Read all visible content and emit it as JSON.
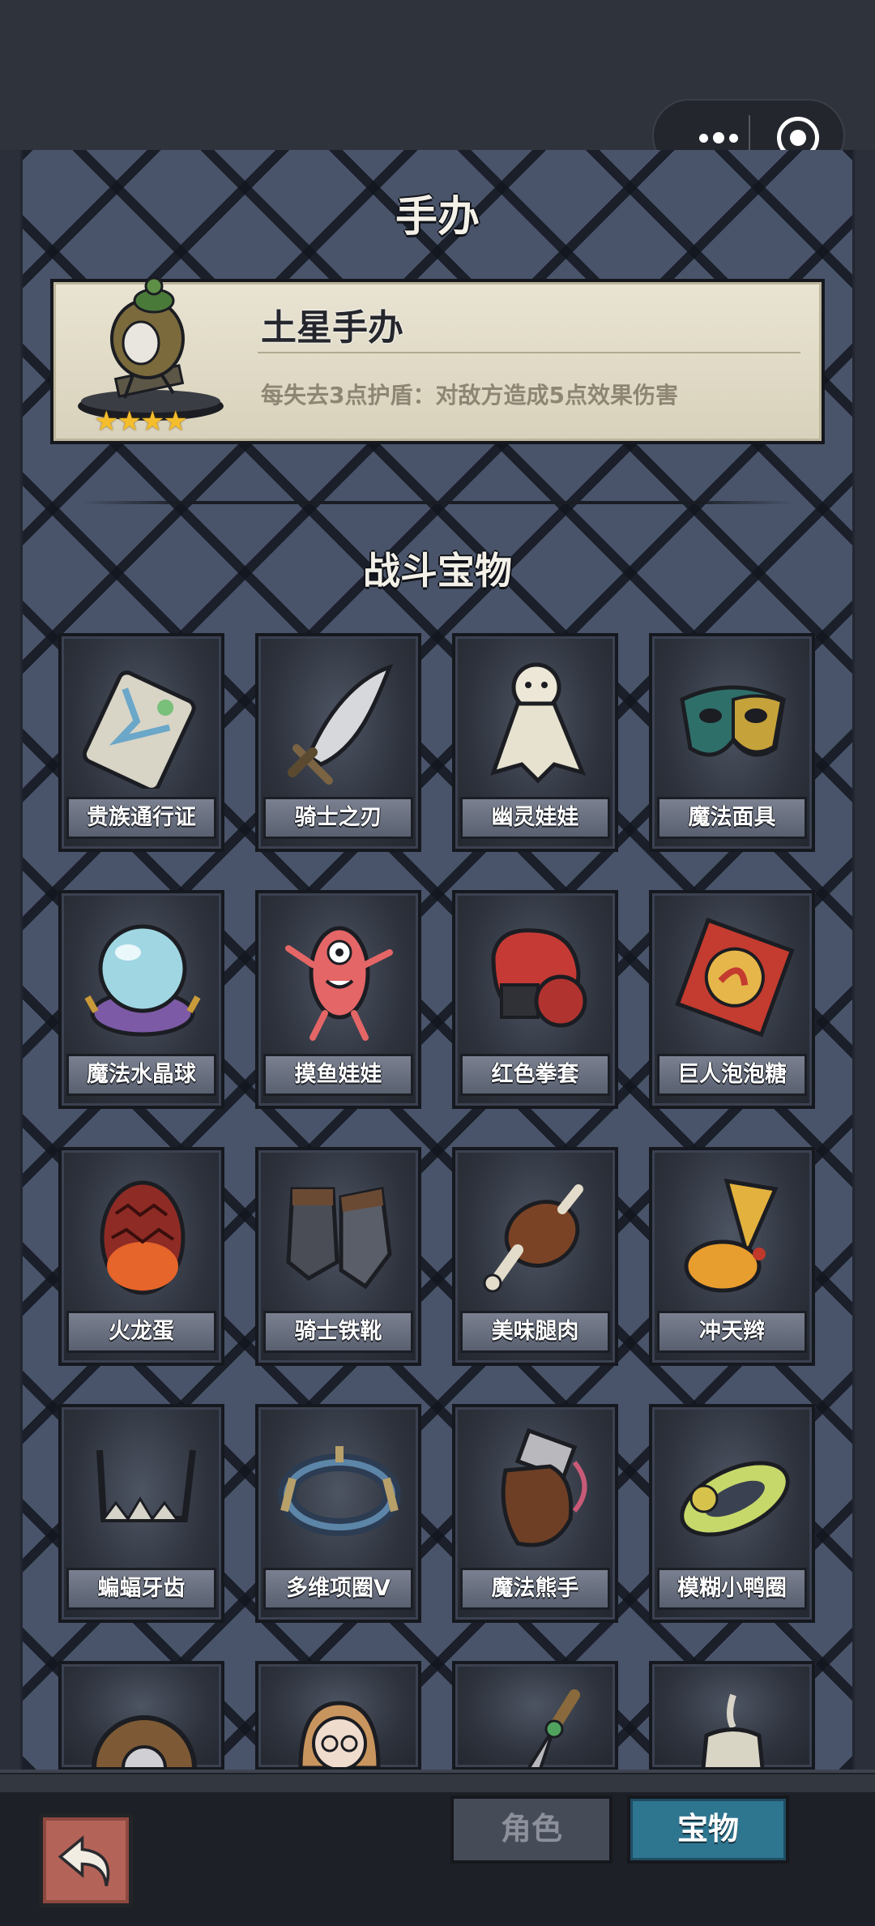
{
  "header": {
    "title": "手办",
    "more_icon": "more-dots-icon",
    "close_icon": "target-close-icon"
  },
  "figure": {
    "name": "土星手办",
    "description": "每失去3点护盾：对敌方造成5点效果伤害",
    "stars": 4
  },
  "section": {
    "title": "战斗宝物"
  },
  "items": [
    {
      "label": "贵族通行证",
      "icon": "noble-pass-card-icon"
    },
    {
      "label": "骑士之刃",
      "icon": "knight-blade-icon"
    },
    {
      "label": "幽灵娃娃",
      "icon": "ghost-doll-icon"
    },
    {
      "label": "魔法面具",
      "icon": "magic-mask-icon"
    },
    {
      "label": "魔法水晶球",
      "icon": "crystal-ball-icon"
    },
    {
      "label": "摸鱼娃娃",
      "icon": "slacker-doll-icon"
    },
    {
      "label": "红色拳套",
      "icon": "red-boxing-glove-icon"
    },
    {
      "label": "巨人泡泡糖",
      "icon": "giant-bubblegum-icon"
    },
    {
      "label": "火龙蛋",
      "icon": "fire-dragon-egg-icon"
    },
    {
      "label": "骑士铁靴",
      "icon": "knight-iron-boots-icon"
    },
    {
      "label": "美味腿肉",
      "icon": "drumstick-icon"
    },
    {
      "label": "冲天辫",
      "icon": "ponytail-icon"
    },
    {
      "label": "蝙蝠牙齿",
      "icon": "bat-teeth-icon"
    },
    {
      "label": "多维项圈V",
      "icon": "collar-icon"
    },
    {
      "label": "魔法熊手",
      "icon": "bear-paw-icon"
    },
    {
      "label": "模糊小鸭圈",
      "icon": "duck-ring-icon"
    },
    {
      "label": "",
      "icon": "wooden-shield-icon"
    },
    {
      "label": "",
      "icon": "girl-doll-icon"
    },
    {
      "label": "",
      "icon": "dagger-icon"
    },
    {
      "label": "",
      "icon": "candle-icon"
    }
  ],
  "bottom_nav": {
    "back_icon": "back-arrow-icon",
    "tabs": [
      {
        "label": "角色",
        "active": false
      },
      {
        "label": "宝物",
        "active": true
      }
    ]
  },
  "colors": {
    "panel": "#49546a",
    "active_tab": "#2e7590",
    "back_button": "#b46358"
  }
}
